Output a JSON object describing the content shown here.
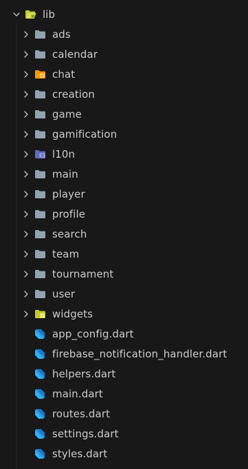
{
  "explorer": {
    "root": {
      "label": "lib",
      "icon": "folder-lib-open-icon",
      "expanded": true
    },
    "folders": [
      {
        "label": "ads",
        "icon": "folder-icon"
      },
      {
        "label": "calendar",
        "icon": "folder-icon"
      },
      {
        "label": "chat",
        "icon": "folder-chat-icon"
      },
      {
        "label": "creation",
        "icon": "folder-icon"
      },
      {
        "label": "game",
        "icon": "folder-icon"
      },
      {
        "label": "gamification",
        "icon": "folder-icon"
      },
      {
        "label": "l10n",
        "icon": "folder-l10n-icon"
      },
      {
        "label": "main",
        "icon": "folder-icon"
      },
      {
        "label": "player",
        "icon": "folder-icon"
      },
      {
        "label": "profile",
        "icon": "folder-icon"
      },
      {
        "label": "search",
        "icon": "folder-icon"
      },
      {
        "label": "team",
        "icon": "folder-icon"
      },
      {
        "label": "tournament",
        "icon": "folder-icon"
      },
      {
        "label": "user",
        "icon": "folder-icon"
      },
      {
        "label": "widgets",
        "icon": "folder-widgets-icon"
      }
    ],
    "files": [
      {
        "label": "app_config.dart",
        "icon": "dart-icon"
      },
      {
        "label": "firebase_notification_handler.dart",
        "icon": "dart-icon"
      },
      {
        "label": "helpers.dart",
        "icon": "dart-icon"
      },
      {
        "label": "main.dart",
        "icon": "dart-icon"
      },
      {
        "label": "routes.dart",
        "icon": "dart-icon"
      },
      {
        "label": "settings.dart",
        "icon": "dart-icon"
      },
      {
        "label": "styles.dart",
        "icon": "dart-icon"
      }
    ]
  },
  "colors": {
    "background": "#181818",
    "text": "#cccccc",
    "folder": "#90a4ae",
    "folder_lib": "#c0ca33",
    "folder_chat": "#ff9800",
    "folder_l10n": "#5c6bc0",
    "dart": "#1e88e5"
  }
}
